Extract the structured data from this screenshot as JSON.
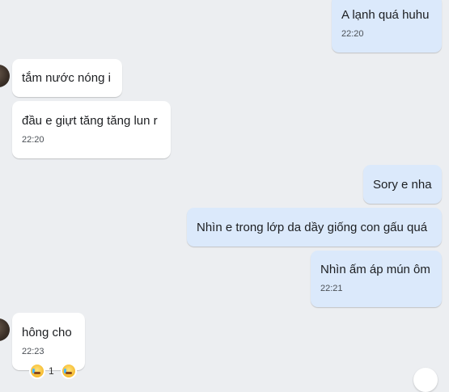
{
  "messages": [
    {
      "direction": "out",
      "text": "A lạnh quá huhu",
      "time": "22:20"
    },
    {
      "direction": "in",
      "text": "tắm nước nóng i",
      "time": ""
    },
    {
      "direction": "in",
      "text": "đầu e giựt tăng tăng lun r",
      "time": "22:20"
    },
    {
      "direction": "out",
      "text": "Sory e nha",
      "time": ""
    },
    {
      "direction": "out",
      "text": "Nhìn e trong lớp da dầy giống con gấu quá",
      "time": ""
    },
    {
      "direction": "out",
      "text": "Nhìn ấm áp mún ôm",
      "time": "22:21"
    },
    {
      "direction": "in",
      "text": "hông cho",
      "time": "22:23"
    }
  ],
  "reactions": {
    "emoji_icon": "crying-face-icon",
    "count": "1"
  },
  "colors": {
    "background": "#eceef1",
    "incoming_bubble": "#ffffff",
    "outgoing_bubble": "#dbe9fb"
  }
}
